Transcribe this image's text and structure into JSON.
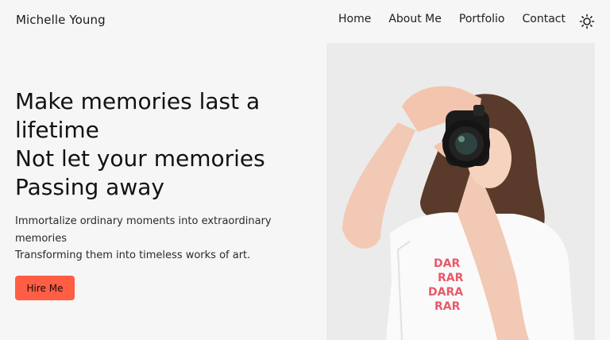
{
  "header": {
    "brand": "Michelle Young",
    "nav": [
      {
        "label": "Home"
      },
      {
        "label": "About Me"
      },
      {
        "label": "Portfolio"
      },
      {
        "label": "Contact"
      }
    ],
    "theme_icon": "sun-icon"
  },
  "hero": {
    "title_lines": [
      "Make memories last a",
      "lifetime",
      "Not let your memories",
      "Passing away"
    ],
    "subtitle_lines": [
      "Immortalize ordinary moments into extraordinary",
      "memories",
      "Transforming them into timeless works of art."
    ],
    "cta_label": "Hire Me"
  },
  "photo": {
    "subject": "woman-with-camera-photo"
  },
  "colors": {
    "accent": "#ff5e44",
    "background": "#f6f6f6",
    "photo_background": "#ebebeb"
  }
}
